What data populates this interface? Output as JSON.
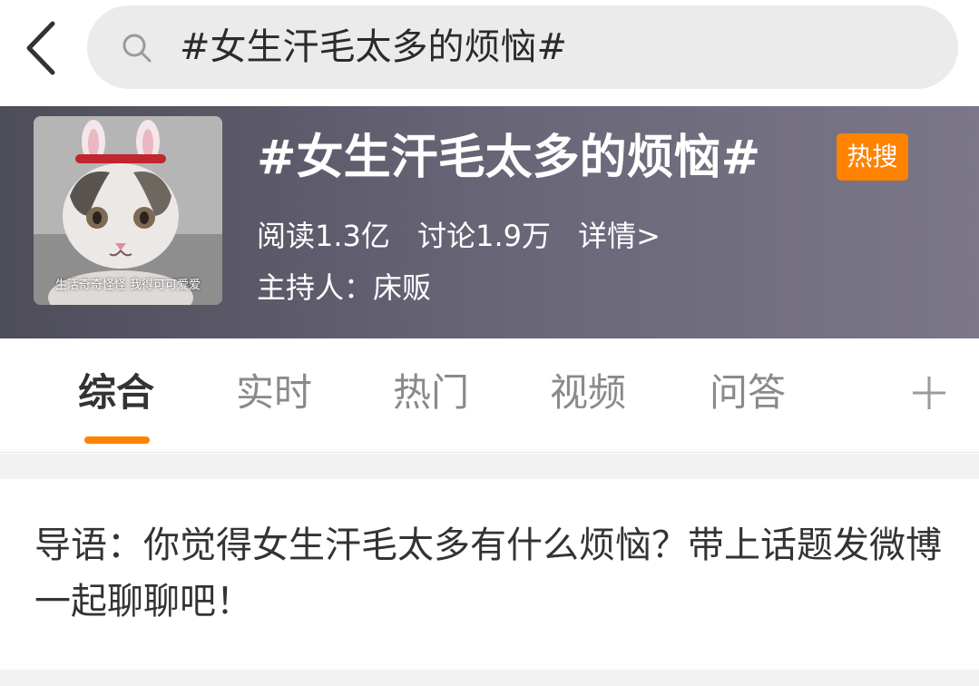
{
  "search": {
    "query": "#女生汗毛太多的烦恼#"
  },
  "topic": {
    "avatar_caption": "生活奇奇怪怪 我得可可爱爱",
    "title": "#女生汗毛太多的烦恼#",
    "badge": "热搜",
    "reads": "阅读1.3亿",
    "discussions": "讨论1.9万",
    "detail_link": "详情>",
    "host": "主持人：床贩"
  },
  "tabs": [
    {
      "label": "综合",
      "active": true
    },
    {
      "label": "实时",
      "active": false
    },
    {
      "label": "热门",
      "active": false
    },
    {
      "label": "视频",
      "active": false
    },
    {
      "label": "问答",
      "active": false
    }
  ],
  "intro": {
    "text": "导语：你觉得女生汗毛太多有什么烦恼？带上话题发微博一起聊聊吧！"
  },
  "colors": {
    "accent": "#ff8200",
    "header_bg": "#5f5c6d"
  },
  "icons": [
    "back-arrow-icon",
    "search-icon",
    "plus-icon"
  ]
}
